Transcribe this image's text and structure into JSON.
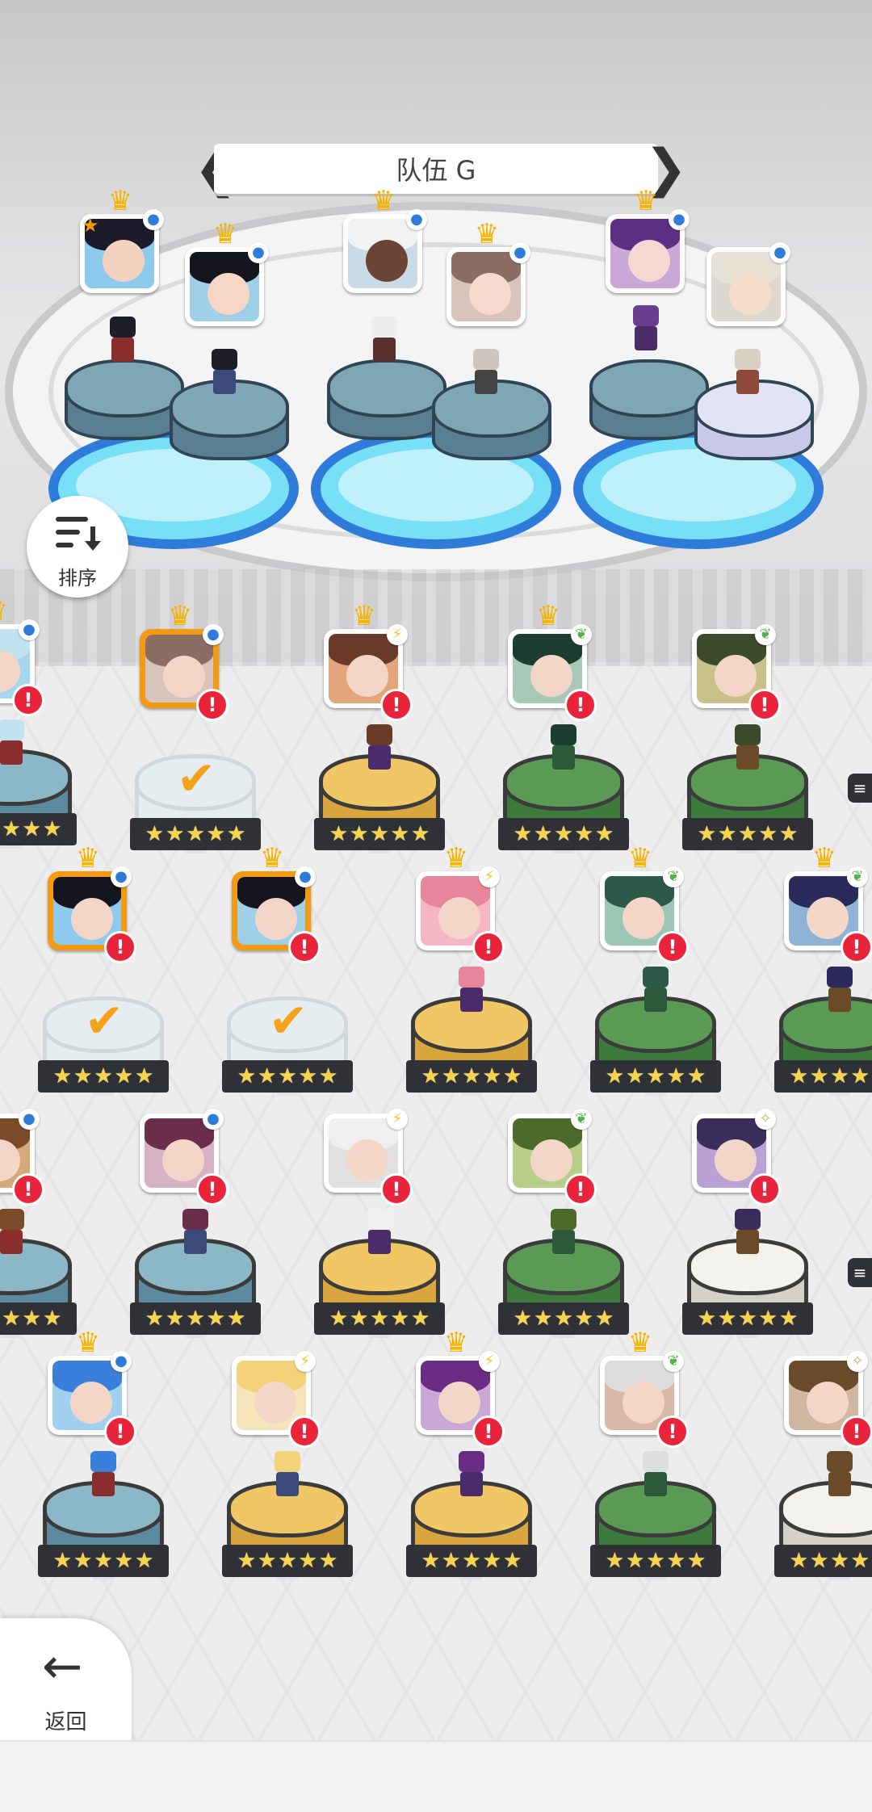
{
  "team": {
    "title": "队伍 G",
    "prev_icon": "chevron-left-icon",
    "next_icon": "chevron-right-icon"
  },
  "controls": {
    "sort_label": "排序",
    "back_label": "返回"
  },
  "colors": {
    "alert": "#e8233a",
    "selected": "#f39a12",
    "crown": "#f4b400",
    "pool": "#2f7bd9"
  },
  "formation": [
    {
      "name": "slot-1-leader",
      "element": "water-icon",
      "leader_star": true
    },
    {
      "name": "slot-1-support",
      "element": "water-icon"
    },
    {
      "name": "slot-2-leader",
      "element": "water-icon"
    },
    {
      "name": "slot-2-support",
      "element": "water-icon"
    },
    {
      "name": "slot-3-leader",
      "element": "water-icon"
    },
    {
      "name": "slot-3-support",
      "element": "water-icon"
    }
  ],
  "roster": {
    "star_count": 5,
    "alert_mark": "!",
    "check_mark": "✔"
  }
}
